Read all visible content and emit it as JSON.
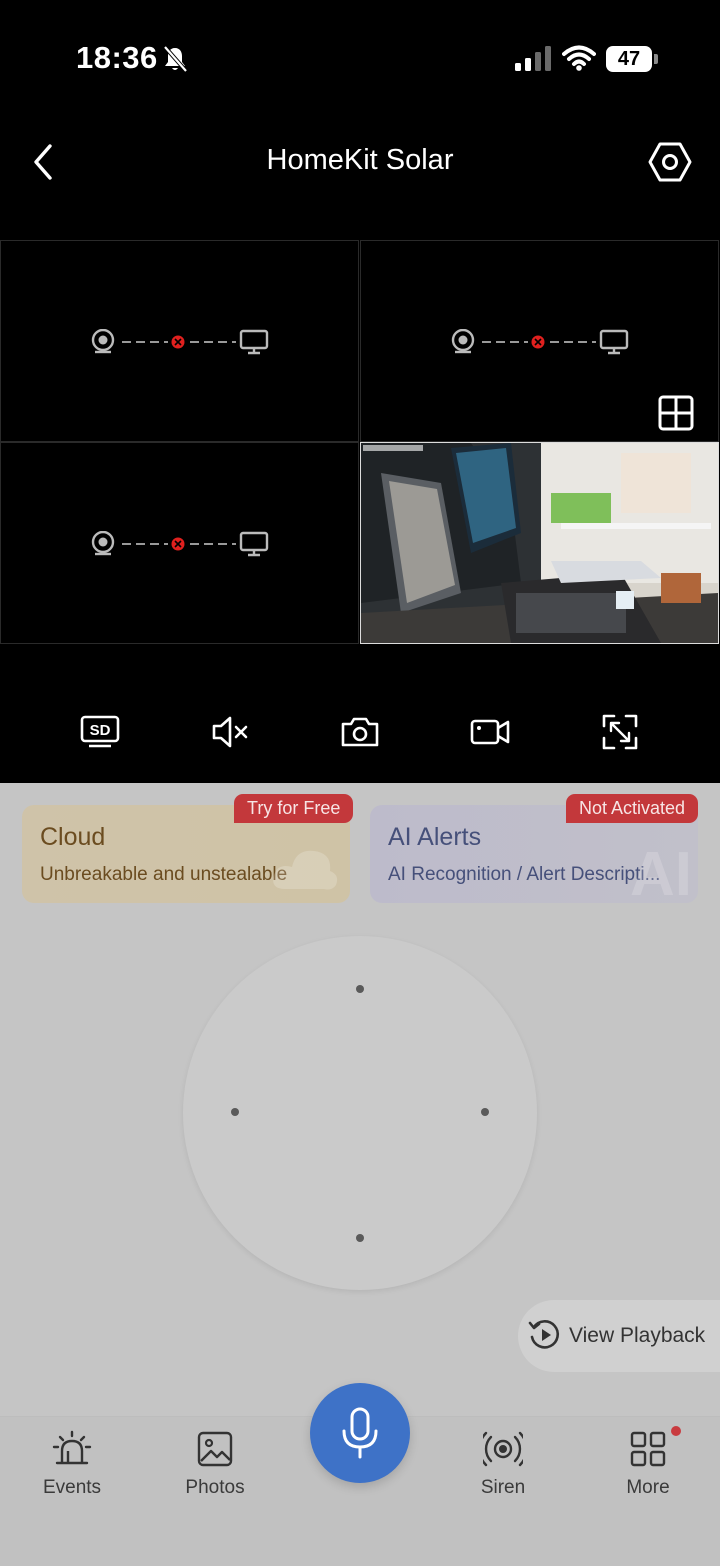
{
  "status_bar": {
    "time": "18:36",
    "battery": "47",
    "icons": [
      "bell-slash-icon",
      "cellular-signal-icon",
      "wifi-icon",
      "battery-icon"
    ]
  },
  "header": {
    "title": "HomeKit Solar",
    "back_icon": "chevron-left-icon",
    "settings_icon": "hexagon-gear-icon"
  },
  "camera_grid": {
    "cells": [
      {
        "state": "disconnected"
      },
      {
        "state": "disconnected"
      },
      {
        "state": "disconnected"
      },
      {
        "state": "live"
      }
    ],
    "layout_toggle_icon": "grid-2x2-icon",
    "accent_error": "#e0201e"
  },
  "controls": {
    "items": [
      "sd-quality-icon",
      "mute-icon",
      "snapshot-camera-icon",
      "record-video-icon",
      "fullscreen-icon"
    ],
    "sd_label": "SD"
  },
  "cards": {
    "cloud": {
      "title": "Cloud",
      "subtitle": "Unbreakable and unstealable",
      "badge": "Try for Free"
    },
    "ai": {
      "title": "AI Alerts",
      "subtitle": "AI Recognition / Alert Descripti...",
      "badge": "Not Activated",
      "watermark": "AI"
    }
  },
  "playback": {
    "label": "View Playback"
  },
  "bottom_nav": {
    "items": [
      {
        "label": "Events",
        "icon": "siren-light-icon"
      },
      {
        "label": "Photos",
        "icon": "image-icon"
      },
      {
        "label": "Siren",
        "icon": "broadcast-icon"
      },
      {
        "label": "More",
        "icon": "grid-icon"
      }
    ],
    "mic_icon": "microphone-icon"
  },
  "colors": {
    "mic_blue": "#3e72c7",
    "badge_red": "#c3383b"
  }
}
